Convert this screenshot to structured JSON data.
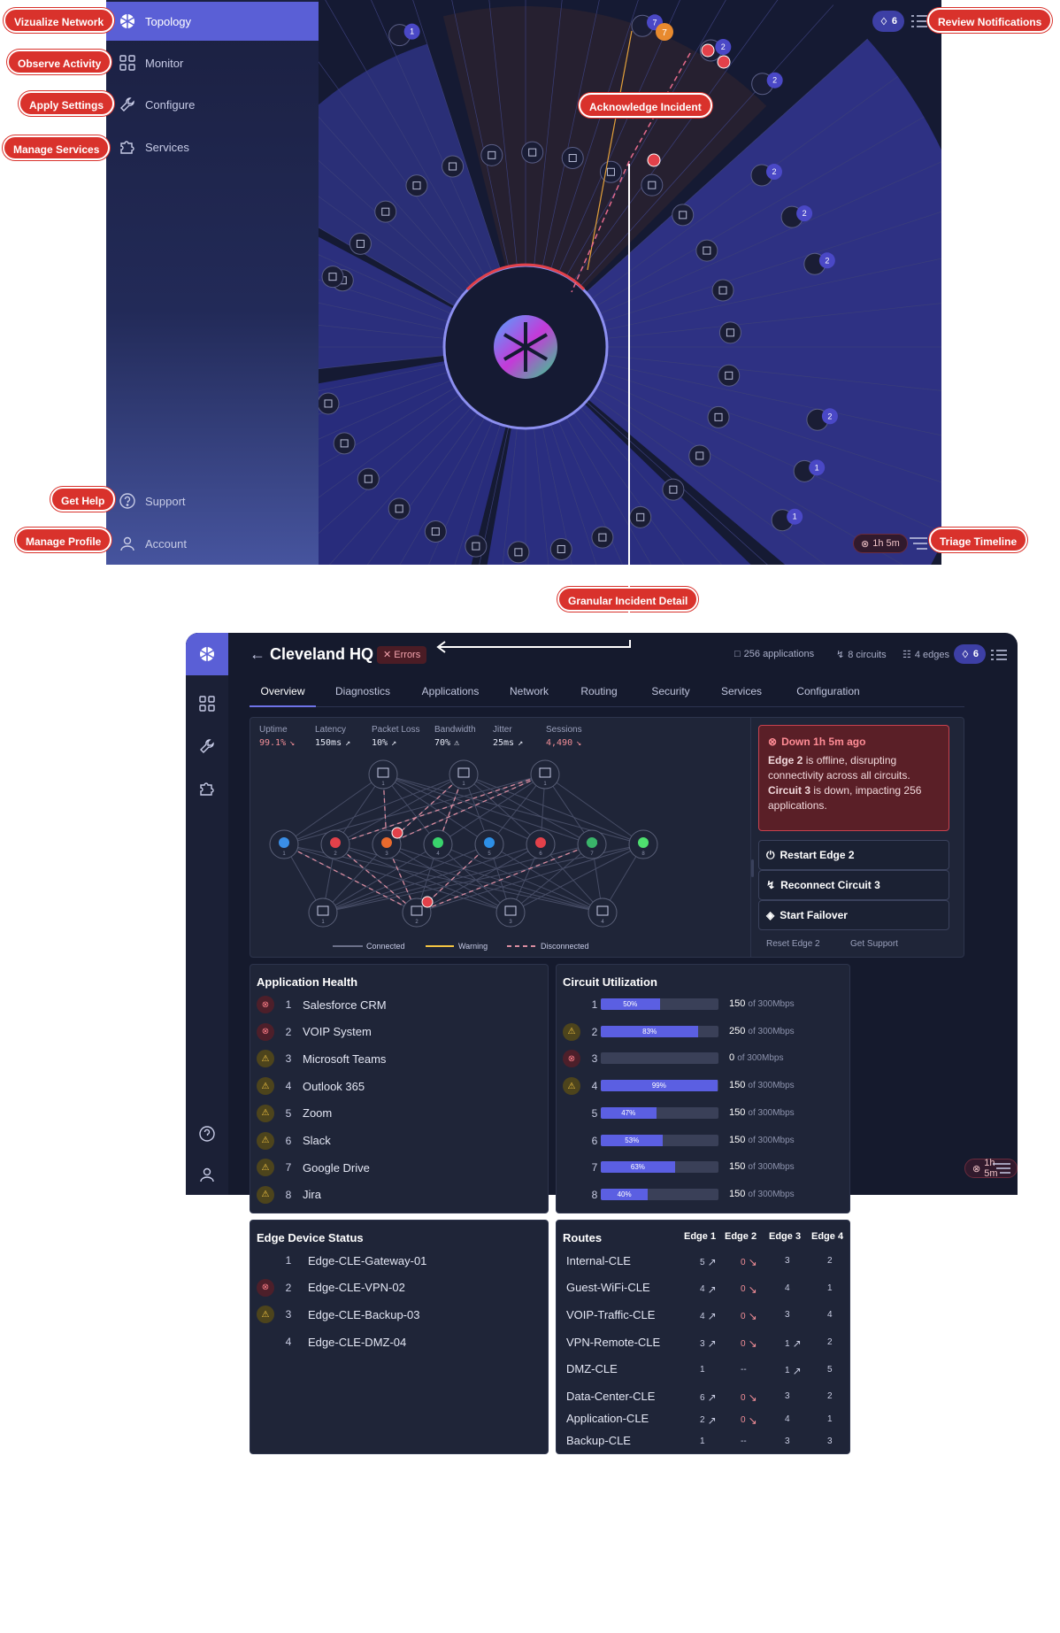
{
  "callouts": {
    "visualize": "Vizualize Network",
    "observe": "Observe Activity",
    "apply": "Apply Settings",
    "manage_services": "Manage Services",
    "get_help": "Get Help",
    "manage_profile": "Manage Profile",
    "review_notifications": "Review Notifications",
    "acknowledge": "Acknowledge Incident",
    "triage": "Triage Timeline",
    "granular": "Granular Incident Detail"
  },
  "nav": {
    "topology": "Topology",
    "monitor": "Monitor",
    "configure": "Configure",
    "services": "Services",
    "support": "Support",
    "account": "Account"
  },
  "topology": {
    "notification_count": "6",
    "timer": "1h 5m",
    "rim_counts": [
      "1",
      "1",
      "1",
      "1",
      "7",
      "2",
      "2",
      "2",
      "2",
      "2",
      "2"
    ],
    "warn_count": "7"
  },
  "colors": {
    "accent": "#5a5fd6",
    "error": "#d9322c",
    "warning": "#f4c542",
    "background": "#151a33"
  },
  "detail": {
    "title": "Cleveland HQ",
    "status": "Errors",
    "applications": "256 applications",
    "circuits": "8 circuits",
    "edges": "4 edges",
    "notification_count": "6",
    "timer": "1h 5m",
    "tabs": [
      "Overview",
      "Diagnostics",
      "Applications",
      "Network",
      "Routing",
      "Security",
      "Services",
      "Configuration"
    ],
    "metrics": [
      {
        "label": "Uptime",
        "value": "99.1%",
        "trend": "down"
      },
      {
        "label": "Latency",
        "value": "150ms",
        "trend": "up"
      },
      {
        "label": "Packet Loss",
        "value": "10%",
        "trend": "up"
      },
      {
        "label": "Bandwidth",
        "value": "70%",
        "trend": "warn"
      },
      {
        "label": "Jitter",
        "value": "25ms",
        "trend": "up"
      },
      {
        "label": "Sessions",
        "value": "4,490",
        "trend": "down"
      }
    ],
    "graph": {
      "top_nodes": [
        "1",
        "1",
        "1"
      ],
      "mid_nodes": [
        "1",
        "2",
        "3",
        "4",
        "5",
        "6",
        "7",
        "8"
      ],
      "bottom_nodes": [
        "1",
        "2",
        "3",
        "4"
      ],
      "cox_label": "COX"
    },
    "legend": {
      "connected": "Connected",
      "warning": "Warning",
      "disconnected": "Disconnected"
    },
    "alert": {
      "heading": "Down 1h 5m ago",
      "edge": "Edge 2",
      "edge_text": " is offline, disrupting connectivity across all circuits.",
      "circuit": "Circuit 3",
      "circuit_text": " is down, impacting 256 applications."
    },
    "actions": {
      "restart": "Restart Edge 2",
      "reconnect": "Reconnect Circuit 3",
      "failover": "Start Failover",
      "reset": "Reset Edge 2",
      "support": "Get Support"
    }
  },
  "app_health": {
    "title": "Application Health",
    "items": [
      {
        "index": "1",
        "name": "Salesforce CRM",
        "status": "error"
      },
      {
        "index": "2",
        "name": "VOIP System",
        "status": "error"
      },
      {
        "index": "3",
        "name": "Microsoft Teams",
        "status": "warning"
      },
      {
        "index": "4",
        "name": "Outlook 365",
        "status": "warning"
      },
      {
        "index": "5",
        "name": "Zoom",
        "status": "warning"
      },
      {
        "index": "6",
        "name": "Slack",
        "status": "warning"
      },
      {
        "index": "7",
        "name": "Google Drive",
        "status": "warning"
      },
      {
        "index": "8",
        "name": "Jira",
        "status": "warning"
      }
    ]
  },
  "circuit_util": {
    "title": "Circuit Utilization",
    "items": [
      {
        "index": "1",
        "status": "none",
        "percent": 50,
        "label": "50%",
        "used": "150",
        "cap": "of 300Mbps"
      },
      {
        "index": "2",
        "status": "warning",
        "percent": 83,
        "label": "83%",
        "used": "250",
        "cap": "of 300Mbps"
      },
      {
        "index": "3",
        "status": "error",
        "percent": 0,
        "label": "",
        "used": "0",
        "cap": "of 300Mbps"
      },
      {
        "index": "4",
        "status": "warning",
        "percent": 99,
        "label": "99%",
        "used": "150",
        "cap": "of 300Mbps"
      },
      {
        "index": "5",
        "status": "none",
        "percent": 47,
        "label": "47%",
        "used": "150",
        "cap": "of 300Mbps"
      },
      {
        "index": "6",
        "status": "none",
        "percent": 53,
        "label": "53%",
        "used": "150",
        "cap": "of 300Mbps"
      },
      {
        "index": "7",
        "status": "none",
        "percent": 63,
        "label": "63%",
        "used": "150",
        "cap": "of 300Mbps"
      },
      {
        "index": "8",
        "status": "none",
        "percent": 40,
        "label": "40%",
        "used": "150",
        "cap": "of 300Mbps"
      }
    ]
  },
  "edge_status": {
    "title": "Edge Device Status",
    "items": [
      {
        "index": "1",
        "name": "Edge-CLE-Gateway-01",
        "status": "none"
      },
      {
        "index": "2",
        "name": "Edge-CLE-VPN-02",
        "status": "error"
      },
      {
        "index": "3",
        "name": "Edge-CLE-Backup-03",
        "status": "warning"
      },
      {
        "index": "4",
        "name": "Edge-CLE-DMZ-04",
        "status": "none"
      }
    ]
  },
  "routes": {
    "title": "Routes",
    "headers": [
      "Edge 1",
      "Edge 2",
      "Edge 3",
      "Edge 4"
    ],
    "rows": [
      {
        "name": "Internal-CLE",
        "cells": [
          [
            "5",
            "up"
          ],
          [
            "0",
            "down"
          ],
          [
            "3",
            ""
          ],
          [
            "2",
            ""
          ]
        ]
      },
      {
        "name": "Guest-WiFi-CLE",
        "cells": [
          [
            "4",
            "up"
          ],
          [
            "0",
            "down"
          ],
          [
            "4",
            ""
          ],
          [
            "1",
            ""
          ]
        ]
      },
      {
        "name": "VOIP-Traffic-CLE",
        "cells": [
          [
            "4",
            "up"
          ],
          [
            "0",
            "down"
          ],
          [
            "3",
            ""
          ],
          [
            "4",
            ""
          ]
        ]
      },
      {
        "name": "VPN-Remote-CLE",
        "cells": [
          [
            "3",
            "up"
          ],
          [
            "0",
            "down"
          ],
          [
            "1",
            "up"
          ],
          [
            "2",
            ""
          ]
        ]
      },
      {
        "name": "DMZ-CLE",
        "cells": [
          [
            "1",
            ""
          ],
          [
            "--",
            ""
          ],
          [
            "1",
            "up"
          ],
          [
            "5",
            ""
          ]
        ]
      },
      {
        "name": "Data-Center-CLE",
        "cells": [
          [
            "6",
            "up"
          ],
          [
            "0",
            "down"
          ],
          [
            "3",
            ""
          ],
          [
            "2",
            ""
          ]
        ]
      },
      {
        "name": "Application-CLE",
        "cells": [
          [
            "2",
            "up"
          ],
          [
            "0",
            "down"
          ],
          [
            "4",
            ""
          ],
          [
            "1",
            ""
          ]
        ]
      },
      {
        "name": "Backup-CLE",
        "cells": [
          [
            "1",
            ""
          ],
          [
            "--",
            ""
          ],
          [
            "3",
            ""
          ],
          [
            "3",
            ""
          ]
        ]
      }
    ]
  }
}
